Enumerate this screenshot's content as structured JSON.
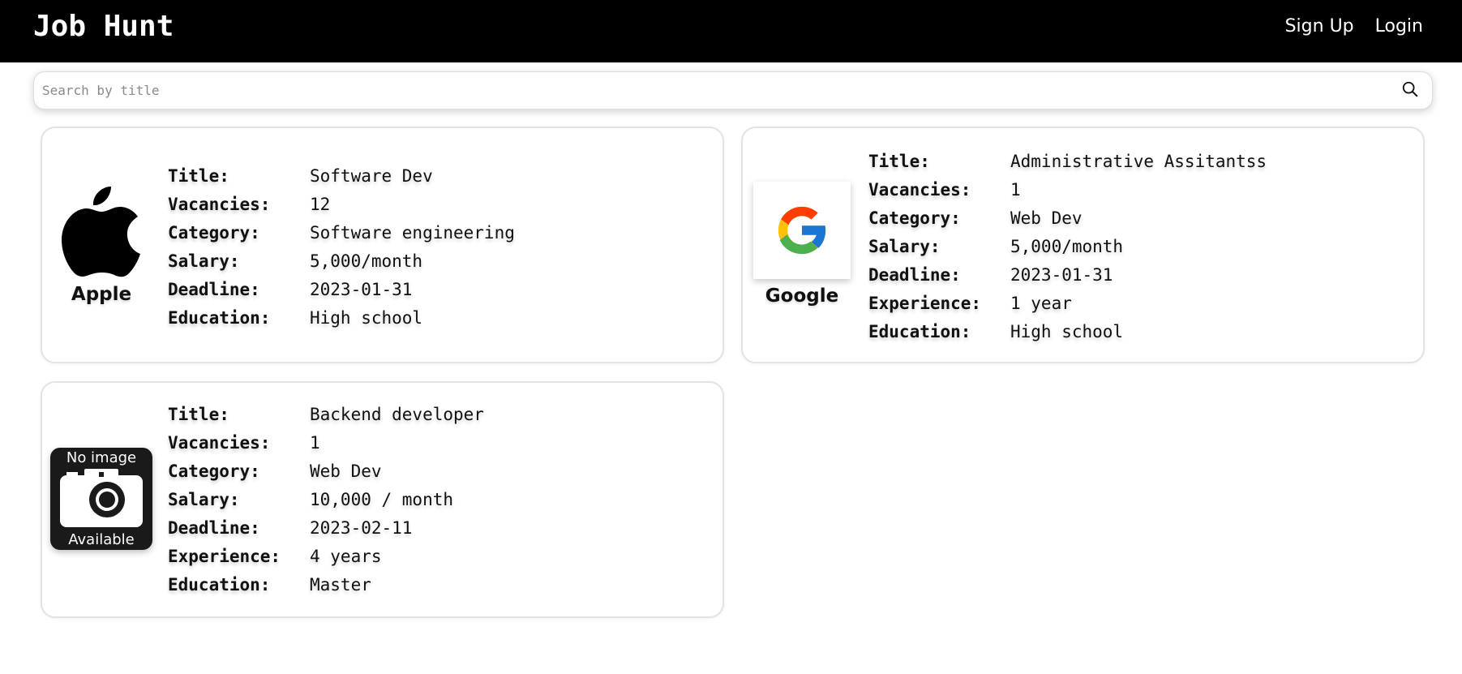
{
  "header": {
    "brand": "Job Hunt",
    "nav": {
      "signup": "Sign Up",
      "login": "Login"
    }
  },
  "search": {
    "placeholder": "Search by title",
    "value": "",
    "icon": "search-icon"
  },
  "jobs": [
    {
      "company": "Apple",
      "logo_icon": "apple-logo",
      "fields": [
        {
          "label": "Title:",
          "value": "Software Dev"
        },
        {
          "label": "Vacancies:",
          "value": "12"
        },
        {
          "label": "Category:",
          "value": "Software engineering"
        },
        {
          "label": "Salary:",
          "value": "5,000/month"
        },
        {
          "label": "Deadline:",
          "value": "2023-01-31"
        },
        {
          "label": "Education:",
          "value": "High school"
        }
      ]
    },
    {
      "company": "Google",
      "logo_icon": "google-logo",
      "fields": [
        {
          "label": "Title:",
          "value": "Administrative Assitantss"
        },
        {
          "label": "Vacancies:",
          "value": "1"
        },
        {
          "label": "Category:",
          "value": "Web Dev"
        },
        {
          "label": "Salary:",
          "value": "5,000/month"
        },
        {
          "label": "Deadline:",
          "value": "2023-01-31"
        },
        {
          "label": "Experience:",
          "value": "1 year"
        },
        {
          "label": "Education:",
          "value": "High school"
        }
      ]
    },
    {
      "company": "",
      "logo_icon": "no-image-placeholder",
      "placeholder_text_top": "No image",
      "placeholder_text_bottom": "Available",
      "fields": [
        {
          "label": "Title:",
          "value": "Backend developer"
        },
        {
          "label": "Vacancies:",
          "value": "1"
        },
        {
          "label": "Category:",
          "value": "Web Dev"
        },
        {
          "label": "Salary:",
          "value": "10,000 / month"
        },
        {
          "label": "Deadline:",
          "value": "2023-02-11"
        },
        {
          "label": "Experience:",
          "value": "4 years"
        },
        {
          "label": "Education:",
          "value": "Master"
        }
      ]
    }
  ],
  "colors": {
    "navbar_bg": "#000000",
    "navbar_text": "#ffffff",
    "card_border": "#e3e3e3"
  }
}
